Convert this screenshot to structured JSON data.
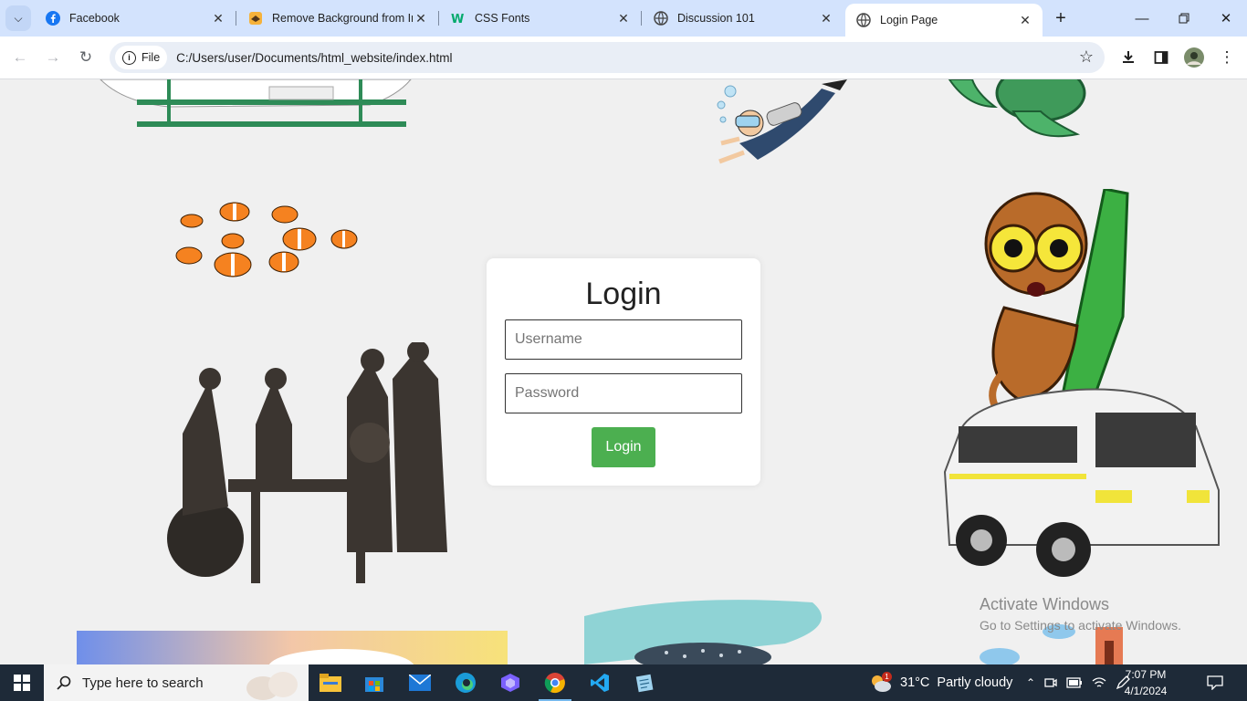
{
  "browser": {
    "tabs": [
      {
        "title": "Facebook",
        "icon": "facebook-icon",
        "active": false
      },
      {
        "title": "Remove Background from In",
        "icon": "removebg-icon",
        "active": false
      },
      {
        "title": "CSS Fonts",
        "icon": "w3schools-icon",
        "active": false
      },
      {
        "title": "Discussion 101",
        "icon": "globe-icon",
        "active": false
      },
      {
        "title": "Login Page",
        "icon": "globe-icon",
        "active": true
      }
    ],
    "omnibox": {
      "chip_label": "File",
      "url": "C:/Users/user/Documents/html_website/index.html"
    }
  },
  "login": {
    "title": "Login",
    "username_placeholder": "Username",
    "password_placeholder": "Password",
    "button_label": "Login"
  },
  "watermark": {
    "line1": "Activate Windows",
    "line2": "Go to Settings to activate Windows."
  },
  "taskbar": {
    "search_placeholder": "Type here to search",
    "weather": {
      "temp": "31°C",
      "condition": "Partly cloudy",
      "badge": "1"
    },
    "time": "7:07 PM",
    "date": "4/1/2024"
  },
  "colors": {
    "tabstrip": "#d3e3fd",
    "login_button": "#4caf50",
    "page_bg": "#f0f0f0",
    "taskbar": "#1e2a38"
  }
}
